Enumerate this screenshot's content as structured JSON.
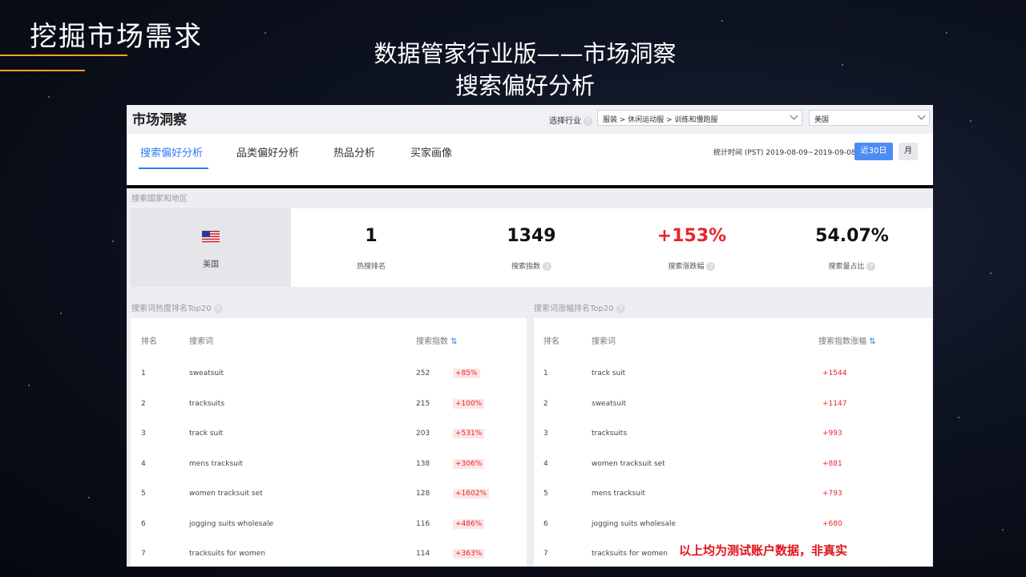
{
  "slide": {
    "title": "挖掘市场需求",
    "center_title_line1": "数据管家行业版——市场洞察",
    "center_title_line2": "搜索偏好分析",
    "footnote": "以上均为测试账户数据，非真实"
  },
  "header": {
    "title": "市场洞察",
    "industry_label": "选择行业",
    "industry_value": "服装 > 休闲运动服 > 训练和慢跑服",
    "country_value": "美国"
  },
  "tabs": [
    {
      "label": "搜索偏好分析",
      "active": true
    },
    {
      "label": "品类偏好分析",
      "active": false
    },
    {
      "label": "热品分析",
      "active": false
    },
    {
      "label": "买家画像",
      "active": false
    }
  ],
  "time": {
    "stat_label": "统计时间 (PST) 2019-08-09~2019-09-08",
    "btn_30": "近30日",
    "btn_month": "月"
  },
  "country_section": {
    "label": "搜索国家和地区",
    "country": "美国",
    "kpis": [
      {
        "value": "1",
        "label": "热搜排名",
        "red": false,
        "help": false
      },
      {
        "value": "1349",
        "label": "搜索指数",
        "red": false,
        "help": true
      },
      {
        "value": "+153%",
        "label": "搜索涨跌幅",
        "red": true,
        "help": true
      },
      {
        "value": "54.07%",
        "label": "搜索量占比",
        "red": false,
        "help": true
      }
    ]
  },
  "hot_table": {
    "title": "搜索词热度排名Top20",
    "headers": {
      "rank": "排名",
      "term": "搜索词",
      "index": "搜索指数"
    },
    "rows": [
      {
        "rank": "1",
        "term": "sweatsuit",
        "index": "252",
        "change": "+85%"
      },
      {
        "rank": "2",
        "term": "tracksuits",
        "index": "215",
        "change": "+100%"
      },
      {
        "rank": "3",
        "term": "track suit",
        "index": "203",
        "change": "+531%"
      },
      {
        "rank": "4",
        "term": "mens tracksuit",
        "index": "138",
        "change": "+306%"
      },
      {
        "rank": "5",
        "term": "women tracksuit set",
        "index": "128",
        "change": "+1602%"
      },
      {
        "rank": "6",
        "term": "jogging suits wholesale",
        "index": "116",
        "change": "+486%"
      },
      {
        "rank": "7",
        "term": "tracksuits for women",
        "index": "114",
        "change": "+363%"
      }
    ]
  },
  "growth_table": {
    "title": "搜索词涨幅排名Top20",
    "headers": {
      "rank": "排名",
      "term": "搜索词",
      "growth": "搜索指数涨幅"
    },
    "rows": [
      {
        "rank": "1",
        "term": "track suit",
        "growth": "+1544"
      },
      {
        "rank": "2",
        "term": "sweatsuit",
        "growth": "+1147"
      },
      {
        "rank": "3",
        "term": "tracksuits",
        "growth": "+993"
      },
      {
        "rank": "4",
        "term": "women tracksuit set",
        "growth": "+881"
      },
      {
        "rank": "5",
        "term": "mens tracksuit",
        "growth": "+793"
      },
      {
        "rank": "6",
        "term": "jogging suits wholesale",
        "growth": "+680"
      },
      {
        "rank": "7",
        "term": "tracksuits for women",
        "growth": ""
      }
    ]
  },
  "colors": {
    "accent": "#2e7cf6",
    "up": "#e8242c",
    "deco": "#f0a12a"
  }
}
